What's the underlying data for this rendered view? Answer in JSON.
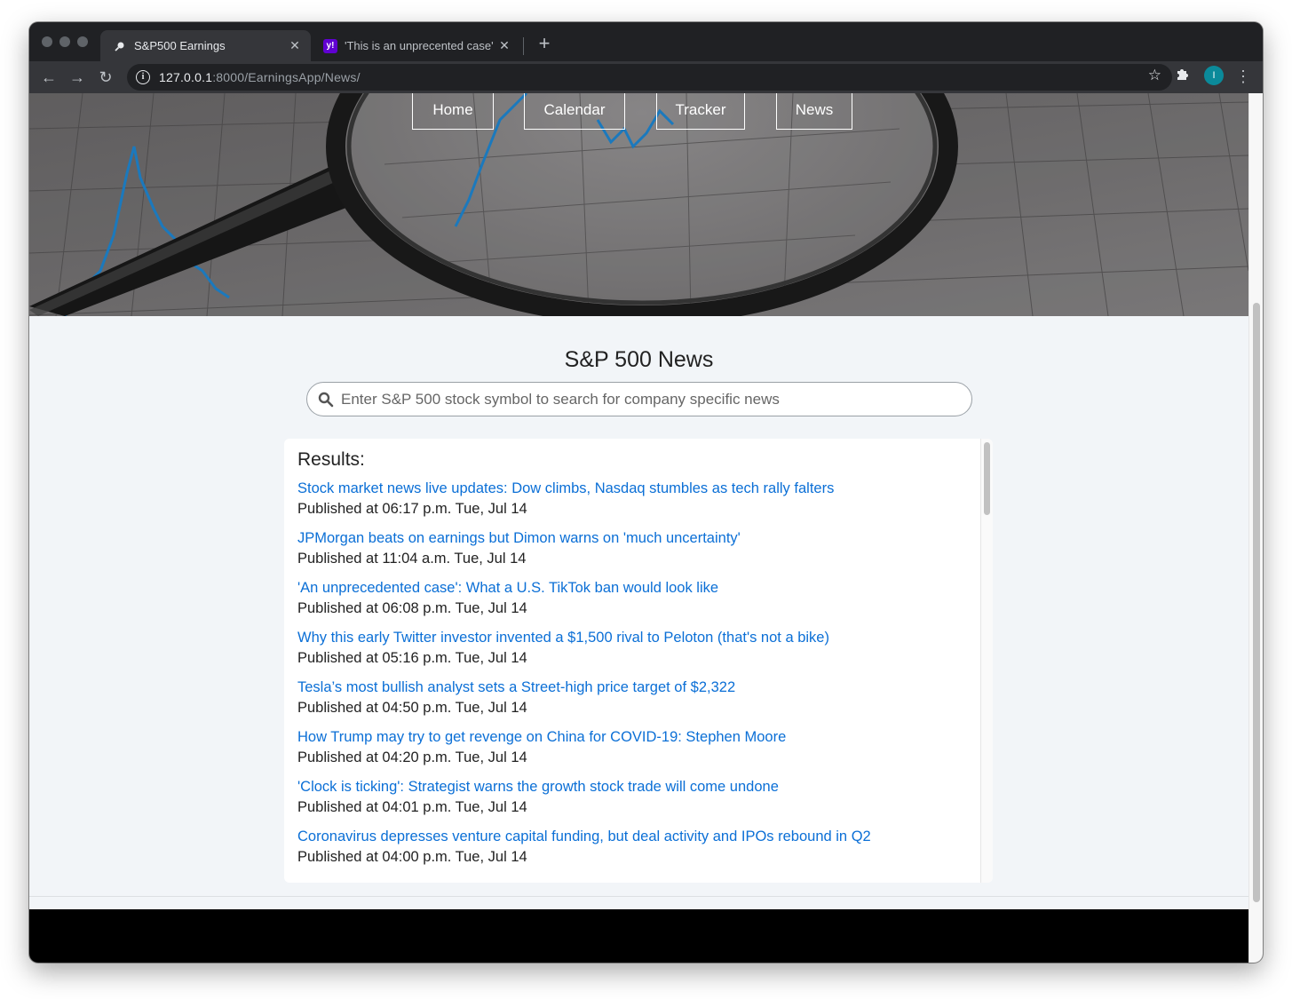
{
  "browser": {
    "tabs": [
      {
        "title": "S&P500 Earnings",
        "favicon": "magnifier-icon",
        "active": true
      },
      {
        "title": "'This is an unprecented case' W",
        "favicon": "yahoo-icon",
        "active": false
      }
    ],
    "url_host": "127.0.0.1",
    "url_rest": ":8000/EarningsApp/News/",
    "avatar_letter": "I",
    "accent_avatar": "#0b8a9a"
  },
  "nav": {
    "items": [
      "Home",
      "Calendar",
      "Tracker",
      "News"
    ]
  },
  "main": {
    "title": "S&P 500 News",
    "search_placeholder": "Enter S&P 500 stock symbol to search for company specific news",
    "results_title": "Results:",
    "results": [
      {
        "headline": "Stock market news live updates: Dow climbs, Nasdaq stumbles as tech rally falters",
        "published": "Published at 06:17 p.m. Tue, Jul 14"
      },
      {
        "headline": "JPMorgan beats on earnings but Dimon warns on 'much uncertainty'",
        "published": "Published at 11:04 a.m. Tue, Jul 14"
      },
      {
        "headline": "'An unprecedented case': What a U.S. TikTok ban would look like",
        "published": "Published at 06:08 p.m. Tue, Jul 14"
      },
      {
        "headline": "Why this early Twitter investor invented a $1,500 rival to Peloton (that's not a bike)",
        "published": "Published at 05:16 p.m. Tue, Jul 14"
      },
      {
        "headline": "Tesla’s most bullish analyst sets a Street-high price target of $2,322",
        "published": "Published at 04:50 p.m. Tue, Jul 14"
      },
      {
        "headline": "How Trump may try to get revenge on China for COVID-19: Stephen Moore",
        "published": "Published at 04:20 p.m. Tue, Jul 14"
      },
      {
        "headline": "'Clock is ticking': Strategist warns the growth stock trade will come undone",
        "published": "Published at 04:01 p.m. Tue, Jul 14"
      },
      {
        "headline": "Coronavirus depresses venture capital funding, but deal activity and IPOs rebound in Q2",
        "published": "Published at 04:00 p.m. Tue, Jul 14"
      }
    ],
    "link_color": "#0b6fd6"
  }
}
